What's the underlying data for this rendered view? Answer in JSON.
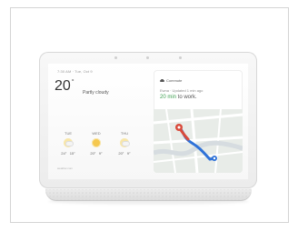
{
  "weather": {
    "time_date": "7:30 AM · Tue, Oct 9",
    "temperature": "20",
    "degree_symbol": "°",
    "condition": "Partly cloudy",
    "forecast": [
      {
        "day": "TUE",
        "high": "24°",
        "low": "15°",
        "icon": "partly-cloudy-icon"
      },
      {
        "day": "WED",
        "high": "20°",
        "low": "9°",
        "icon": "sun-icon"
      },
      {
        "day": "THU",
        "high": "20°",
        "low": "9°",
        "icon": "partly-cloudy-icon"
      }
    ],
    "source": "weather.com"
  },
  "commute": {
    "title": "Commute",
    "update": "Ewna · Updated 1 min ago",
    "eta_highlight": "20 min",
    "eta_rest": " to work.",
    "icon": "car-icon"
  },
  "colors": {
    "eta_green": "#3d9f4f",
    "device_gray": "#e7e7e7",
    "screen_white": "#ffffff",
    "map_route_blue": "#2f72d8",
    "map_route_red": "#d94b3c"
  }
}
